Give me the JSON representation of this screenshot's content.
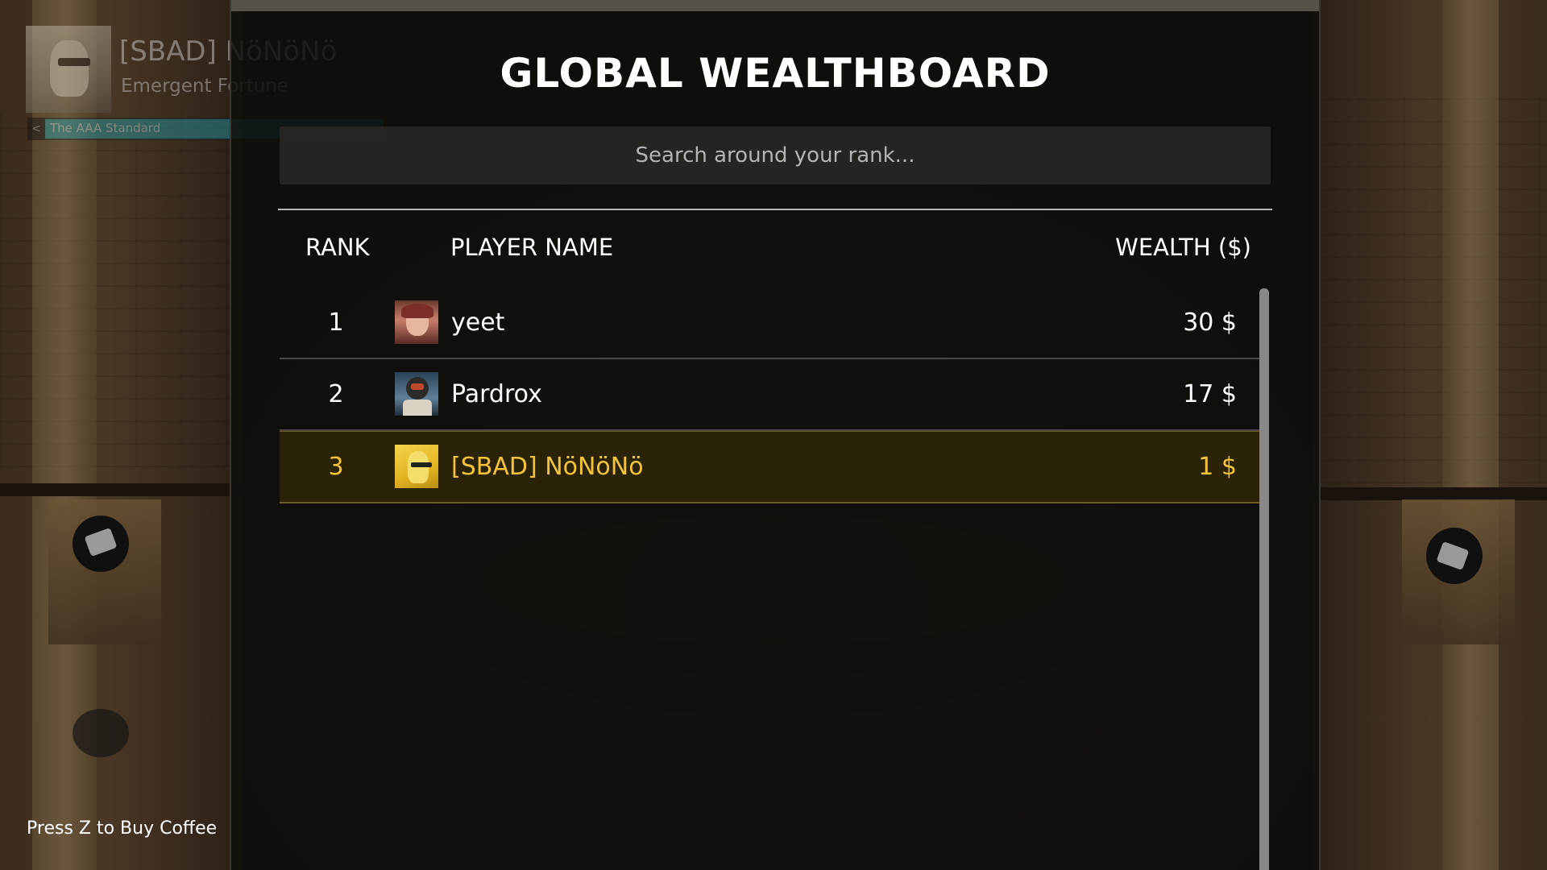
{
  "player": {
    "name": "[SBAD] NöNöNö",
    "title": "Emergent Fortune",
    "xp_label": "The AAA Standard",
    "xp_arrow": "<"
  },
  "leaderboard": {
    "title": "GLOBAL WEALTHBOARD",
    "search_placeholder": "Search around your rank...",
    "columns": {
      "rank": "RANK",
      "player": "PLAYER NAME",
      "wealth": "WEALTH ($)"
    },
    "rows": [
      {
        "rank": "1",
        "name": "yeet",
        "wealth": "30  $",
        "is_self": false
      },
      {
        "rank": "2",
        "name": "Pardrox",
        "wealth": "17  $",
        "is_self": false
      },
      {
        "rank": "3",
        "name": "[SBAD] NöNöNö",
        "wealth": "1  $",
        "is_self": true
      }
    ]
  },
  "footer": {
    "hint": "Press Z to Buy Coffee"
  },
  "colors": {
    "self_highlight": "#f3c33a",
    "xp_bar": "#1fa6b4",
    "modal_bg": "#100e0c"
  }
}
